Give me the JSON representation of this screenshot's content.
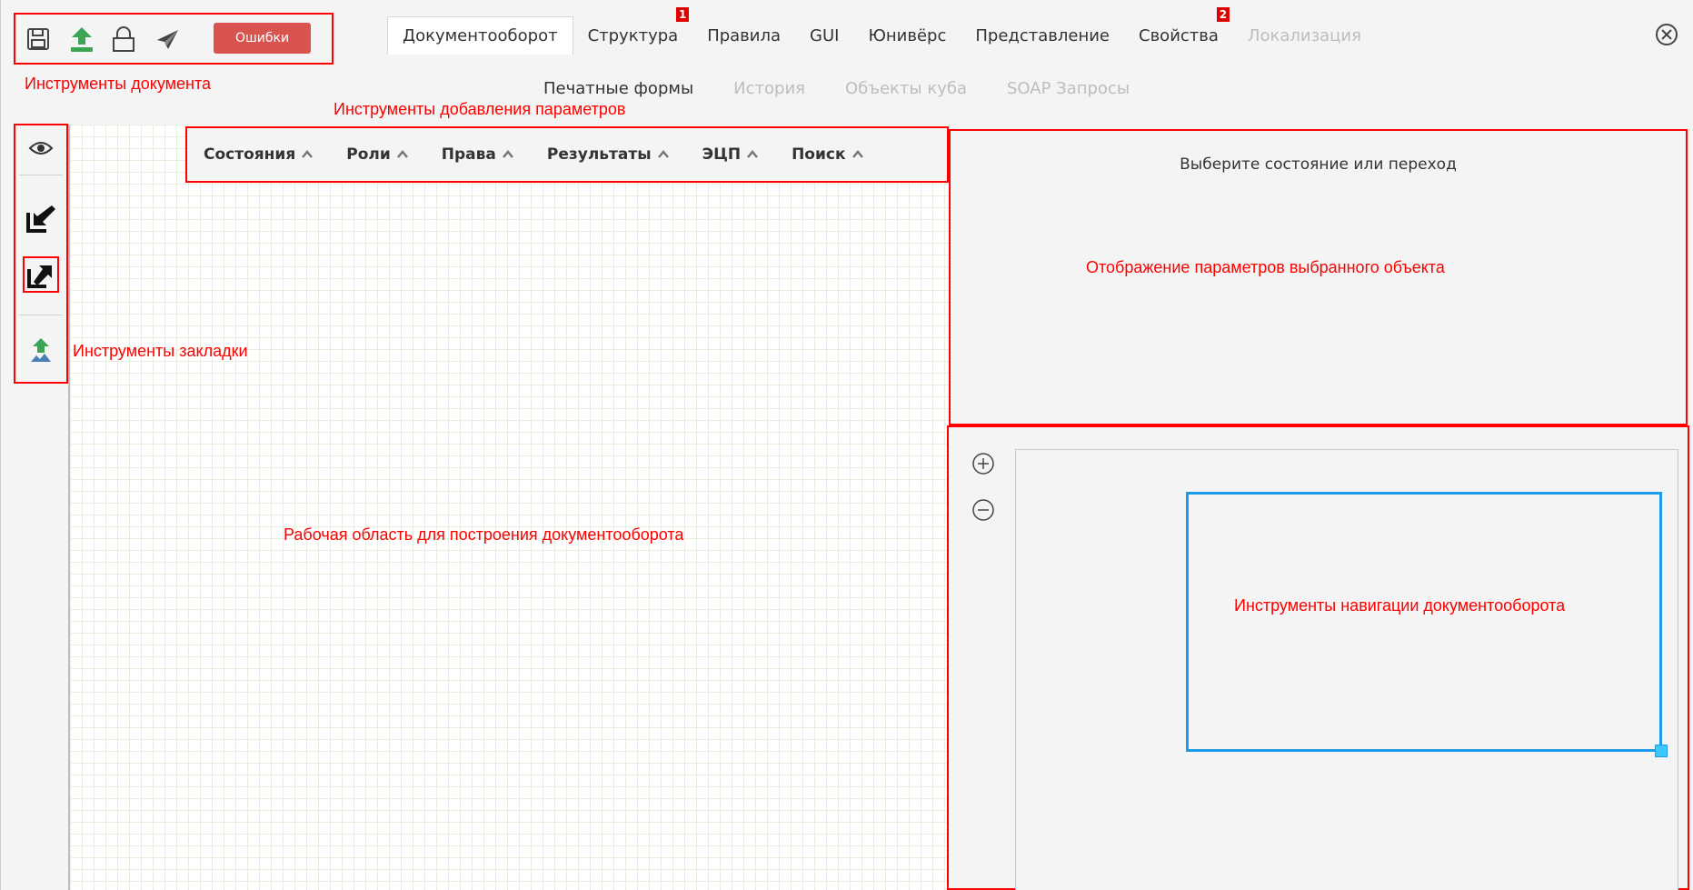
{
  "toolbar": {
    "errors_label": "Ошибки",
    "icons": [
      "save-icon",
      "upload-icon",
      "lock-icon",
      "send-icon"
    ]
  },
  "tabs": [
    {
      "label": "Документооборот",
      "state": "active"
    },
    {
      "label": "Структура",
      "badge": "1"
    },
    {
      "label": "Правила"
    },
    {
      "label": "GUI"
    },
    {
      "label": "Юнивёрс"
    },
    {
      "label": "Представление"
    },
    {
      "label": "Свойства",
      "badge": "2"
    },
    {
      "label": "Локализация",
      "state": "disabled"
    }
  ],
  "sub_tabs": [
    {
      "label": "Печатные формы"
    },
    {
      "label": "История",
      "state": "disabled"
    },
    {
      "label": "Объекты куба",
      "state": "disabled"
    },
    {
      "label": "SOAP Запросы",
      "state": "disabled"
    }
  ],
  "param_bar": {
    "items": [
      "Состояния",
      "Роли",
      "Права",
      "Результаты",
      "ЭЦП",
      "Поиск"
    ]
  },
  "right_panel": {
    "hint": "Выберите состояние или переход"
  },
  "annotations": {
    "doc_tools": "Инструменты документа",
    "param_tools": "Инструменты добавления параметров",
    "tab_tools": "Инструменты закладки",
    "workspace": "Рабочая область для построения документооборота",
    "params_view": "Отображение параметров выбранного объекта",
    "nav_tools": "Инструменты навигации документооборота"
  },
  "colors": {
    "annotation": "#ff0000",
    "errors_button": "#d9534f",
    "viewport": "#1e9be9",
    "badge": "#e00000"
  }
}
